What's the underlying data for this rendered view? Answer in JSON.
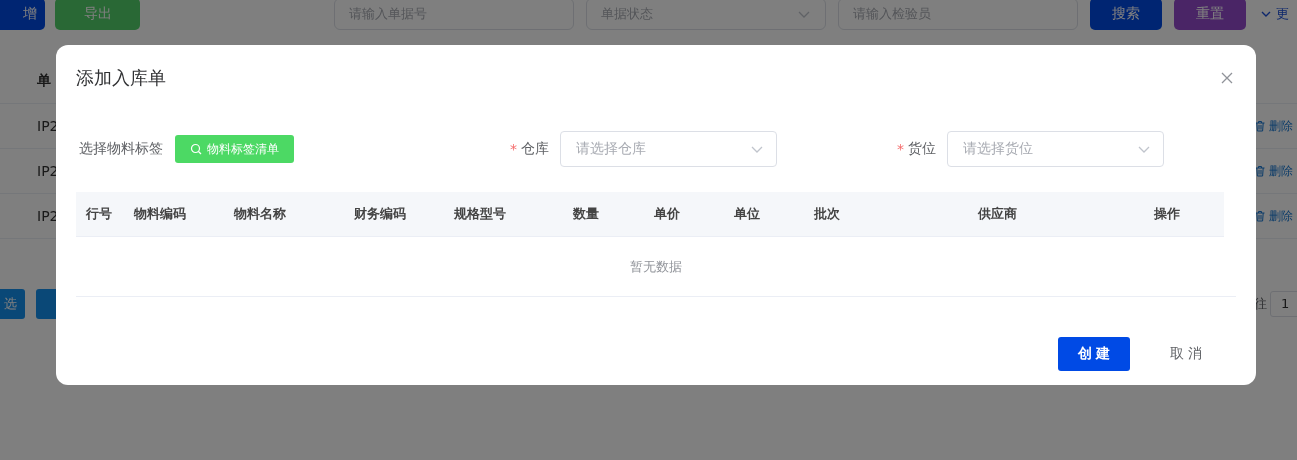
{
  "background_page": {
    "toolbar_buttons": [
      {
        "label": "增",
        "kind": "primary"
      },
      {
        "label": "导出",
        "kind": "success"
      }
    ],
    "filters": [
      {
        "kind": "input",
        "placeholder": "请输入单据号"
      },
      {
        "kind": "select",
        "placeholder": "单据状态"
      },
      {
        "kind": "input",
        "placeholder": "请输入检验员"
      }
    ],
    "search_buttons": [
      {
        "label": "搜索",
        "kind": "primary"
      },
      {
        "label": "重置",
        "kind": "reset"
      }
    ],
    "more_link": "更",
    "table": {
      "column_1": "单",
      "rows": [
        {
          "column_1": "IP2",
          "action": "删除"
        },
        {
          "column_1": "IP2",
          "action": "删除"
        },
        {
          "column_1": "IP2",
          "action": "删除"
        }
      ]
    },
    "bottom_buttons": [
      "选"
    ],
    "pagination": {
      "goto_label": "往",
      "page": "1"
    }
  },
  "dialog": {
    "title": "添加入库单",
    "material_label": "选择物料标签",
    "material_button": "物料标签清单",
    "fields": [
      {
        "required_mark": "*",
        "label": "仓库",
        "placeholder": "请选择仓库"
      },
      {
        "required_mark": "*",
        "label": "货位",
        "placeholder": "请选择货位"
      }
    ],
    "table": {
      "columns": [
        "行号",
        "物料编码",
        "物料名称",
        "财务编码",
        "规格型号",
        "数量",
        "单价",
        "单位",
        "批次",
        "供应商",
        "操作"
      ],
      "empty_text": "暂无数据"
    },
    "buttons": [
      {
        "label": "创建",
        "kind": "primary"
      },
      {
        "label": "取消",
        "kind": "text"
      }
    ]
  }
}
